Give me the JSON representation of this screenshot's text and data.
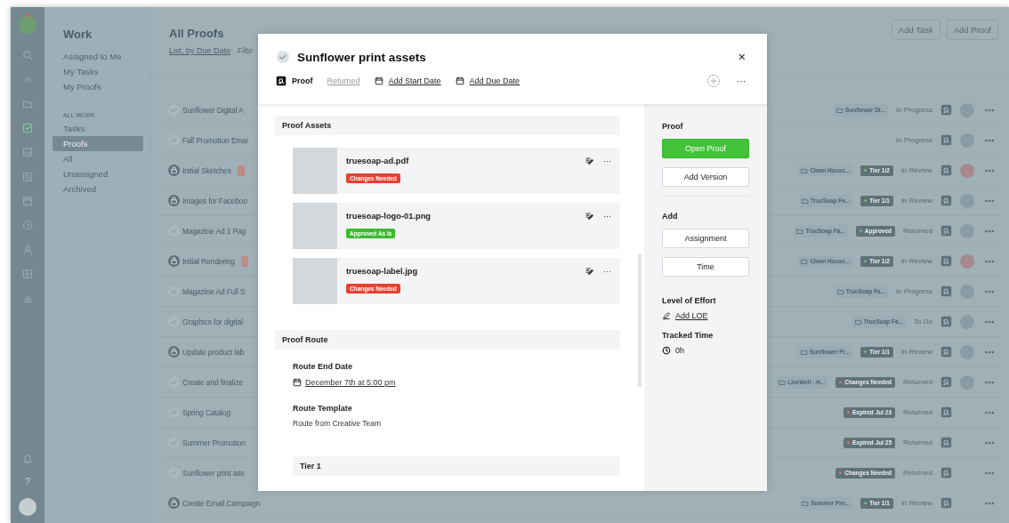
{
  "rail": {
    "items": [
      {
        "kind": "search",
        "selected": false
      },
      {
        "kind": "gauge",
        "selected": false
      },
      {
        "kind": "folder",
        "selected": false
      },
      {
        "kind": "checkbox",
        "selected": true
      },
      {
        "kind": "inbox",
        "selected": false
      },
      {
        "kind": "proof",
        "selected": false
      },
      {
        "kind": "calendar",
        "selected": false
      },
      {
        "kind": "clock",
        "selected": false
      },
      {
        "kind": "person",
        "selected": false
      },
      {
        "kind": "layout",
        "selected": false
      },
      {
        "kind": "chart",
        "selected": false
      }
    ],
    "bottom": [
      {
        "kind": "bell"
      },
      {
        "kind": "help",
        "text": "?"
      },
      {
        "kind": "avatar"
      }
    ]
  },
  "nav": {
    "title": "Work",
    "links": [
      "Assigned to Me",
      "My Tasks",
      "My Proofs"
    ],
    "section": "ALL WORK",
    "items": [
      {
        "label": "Tasks",
        "selected": false
      },
      {
        "label": "Proofs",
        "selected": true
      },
      {
        "label": "All",
        "selected": false
      },
      {
        "label": "Unassigned",
        "selected": false
      },
      {
        "label": "Archived",
        "selected": false
      }
    ]
  },
  "main": {
    "title": "All Proofs",
    "view_link": "List, by Due Date",
    "filter_text": "Filte",
    "buttons": [
      "Add Task",
      "Add Proof"
    ],
    "rows": [
      {
        "title": "Sunflower Digital A",
        "locked": false,
        "cut_badge": false,
        "project": "Sunflower Di...",
        "status": "In Progress",
        "avatar": {
          "color": "#8a9ca3"
        }
      },
      {
        "title": "Fall Promotion Emai",
        "locked": false,
        "cut_badge": false,
        "status": "In Progress",
        "avatar": {
          "color": "#8a9ca3"
        }
      },
      {
        "title": "Initial Sketches",
        "locked": true,
        "cut_badge": true,
        "project": "Clean House...",
        "badge": {
          "label": "Tier 1/2",
          "color": "#74b87a"
        },
        "status": "In Review",
        "avatar": {
          "color": "#a88a8c"
        }
      },
      {
        "title": "Images for Faceboo",
        "locked": true,
        "cut_badge": false,
        "project": "TrueSoap Fa...",
        "badge": {
          "label": "Tier 1/1",
          "color": "#74b87a"
        },
        "status": "In Review",
        "avatar": {
          "color": "#8a9ca3"
        }
      },
      {
        "title": "Magazine Ad 1 Pag",
        "locked": false,
        "cut_badge": false,
        "project": "TrueSoap Fa...",
        "badge": {
          "label": "Approved",
          "color": "#74b87a"
        },
        "status": "Returned",
        "avatar": {
          "color": "#8a9ca3"
        }
      },
      {
        "title": "Initial Rendering",
        "locked": true,
        "cut_badge": true,
        "project": "Clean House...",
        "badge": {
          "label": "Tier 1/2",
          "color": "#74b87a"
        },
        "status": "In Review",
        "avatar": {
          "color": "#a88a8c"
        }
      },
      {
        "title": "Magazine Ad Full S",
        "locked": false,
        "cut_badge": false,
        "project": "TrueSoap Fa...",
        "status": "In Progress",
        "avatar": {
          "color": "#8a9ca3"
        }
      },
      {
        "title": "Graphics for digital",
        "locked": false,
        "cut_badge": false,
        "project": "TrueSoap Fa...",
        "status": "To Do",
        "avatar": {
          "color": "#8a9ca3"
        }
      },
      {
        "title": "Update product lab",
        "locked": true,
        "cut_badge": false,
        "project": "Sunflower Pr...",
        "badge": {
          "label": "Tier 1/1",
          "color": "#74b87a"
        },
        "status": "In Review",
        "avatar": {
          "color": "#8a9ca3"
        }
      },
      {
        "title": "Create and finalize",
        "locked": false,
        "cut_badge": false,
        "project": "LiveWell - H...",
        "badge": {
          "label": "Changes Needed",
          "color": "#c97a78"
        },
        "status": "Returned",
        "avatar": {
          "color": "#8a9ca3"
        }
      },
      {
        "title": "Spring Catalog",
        "locked": false,
        "cut_badge": false,
        "badge": {
          "label": "Expired Jul 23",
          "color": "#c97a78"
        },
        "status": "Returned"
      },
      {
        "title": "Summer Promotion",
        "locked": false,
        "cut_badge": false,
        "badge": {
          "label": "Expired Jul 25",
          "color": "#c97a78"
        },
        "status": "Returned"
      },
      {
        "title": "Sunflower print ass",
        "locked": false,
        "cut_badge": false,
        "badge": {
          "label": "Changes Needed",
          "color": "#c97a78"
        },
        "status": "Returned"
      },
      {
        "title": "Create Email Campaign",
        "locked": true,
        "cut_badge": false,
        "project": "Summer Pro...",
        "badge": {
          "label": "Tier 1/1",
          "color": "#74b87a"
        },
        "status": "In Review"
      }
    ]
  },
  "modal": {
    "title": "Sunflower print assets",
    "close": "×",
    "type": "Proof",
    "state": "Returned",
    "start_date": "Add Start Date",
    "due_date": "Add Due Date",
    "more": "···",
    "assets_heading": "Proof Assets",
    "assets": [
      {
        "name": "truesoap-ad.pdf",
        "status": {
          "label": "Changes Needed",
          "color": "#e8412f"
        },
        "more": "···"
      },
      {
        "name": "truesoap-logo-01.png",
        "status": {
          "label": "Approved As Is",
          "color": "#3dbb2f"
        },
        "more": "···"
      },
      {
        "name": "truesoap-label.jpg",
        "status": {
          "label": "Changes Needed",
          "color": "#e8412f"
        },
        "more": "···"
      }
    ],
    "route_heading": "Proof Route",
    "route_end_label": "Route End Date",
    "route_end_date": "December 7th at 5:00 pm",
    "template_label": "Route Template",
    "template": "Route from Creative Team",
    "tier_heading": "Tier 1",
    "side": {
      "proof_heading": "Proof",
      "open_button": "Open Proof",
      "version_button": "Add Version",
      "add_heading": "Add",
      "add_buttons": [
        "Assignment",
        "Time"
      ],
      "loe_heading": "Level of Effort",
      "loe_link": "Add LOE",
      "tracked_heading": "Tracked Time",
      "tracked": "0h"
    }
  }
}
